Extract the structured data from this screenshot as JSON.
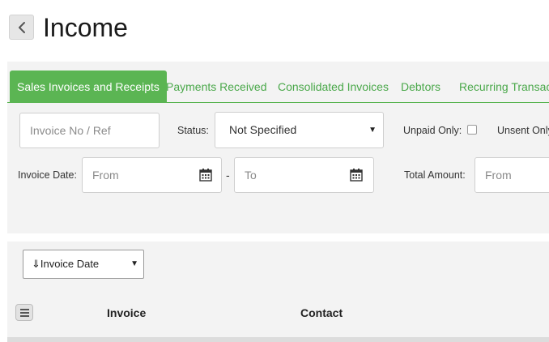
{
  "header": {
    "title": "Income",
    "back_icon": "chevron-left-icon"
  },
  "tabs": [
    {
      "label": "Sales Invoices and Receipts",
      "active": true
    },
    {
      "label": "Payments Received",
      "active": false
    },
    {
      "label": "Consolidated Invoices",
      "active": false
    },
    {
      "label": "Debtors",
      "active": false
    },
    {
      "label": "Recurring Transact",
      "active": false
    }
  ],
  "filters": {
    "invoice_ref_placeholder": "Invoice No / Ref",
    "status_label": "Status:",
    "status_value": "Not Specified",
    "unpaid_only_label": "Unpaid Only:",
    "unsent_only_label": "Unsent Only",
    "invoice_date_label": "Invoice Date:",
    "date_from_placeholder": "From",
    "date_separator": "-",
    "date_to_placeholder": "To",
    "total_amount_label": "Total Amount:",
    "amount_from_placeholder": "From"
  },
  "list": {
    "sort_value": "⇓Invoice Date",
    "columns": [
      "Invoice",
      "Contact"
    ]
  },
  "colors": {
    "accent": "#5bb553",
    "tab_text": "#4aa84a",
    "panel_bg": "#f3f3f3"
  }
}
